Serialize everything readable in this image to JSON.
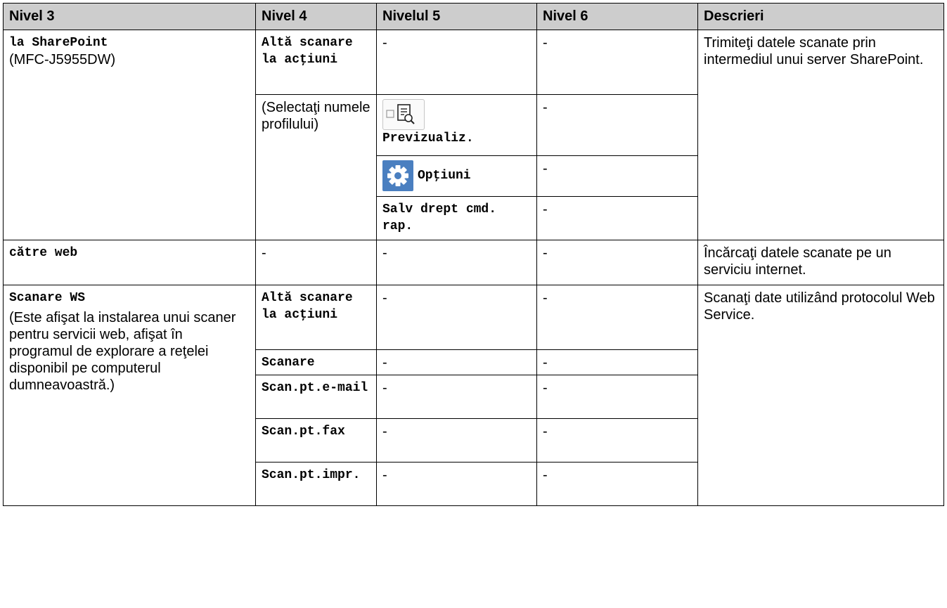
{
  "headers": [
    "Nivel 3",
    "Nivel 4",
    "Nivelul 5",
    "Nivel 6",
    "Descrieri"
  ],
  "dash": "-",
  "sharepoint": {
    "name": "la SharePoint",
    "model": "(MFC-J5955DW)",
    "l4_other": "Altă scanare la acţiuni",
    "l4_profile": "(Selectaţi numele profilului)",
    "l5_preview": "Previzualiz.",
    "l5_options": "Opţiuni",
    "l5_save": "Salv drept cmd. rap.",
    "description": "Trimiteţi datele scanate prin intermediul unui server SharePoint."
  },
  "web": {
    "name": "către web",
    "description": "Încărcaţi datele scanate pe un serviciu internet."
  },
  "ws": {
    "name": "Scanare WS",
    "note": "(Este afişat la instalarea unui scaner pentru servicii web, afişat în programul de explorare a reţelei disponibil pe computerul dumneavoastră.)",
    "l4_items": [
      "Altă scanare la acţiuni",
      "Scanare",
      "Scan.pt.e-mail",
      "Scan.pt.fax",
      "Scan.pt.impr."
    ],
    "description": "Scanaţi date utilizând protocolul Web Service."
  },
  "icons": {
    "preview": "preview-icon",
    "options": "gear-icon",
    "gear_color": "#4a7fc0"
  }
}
